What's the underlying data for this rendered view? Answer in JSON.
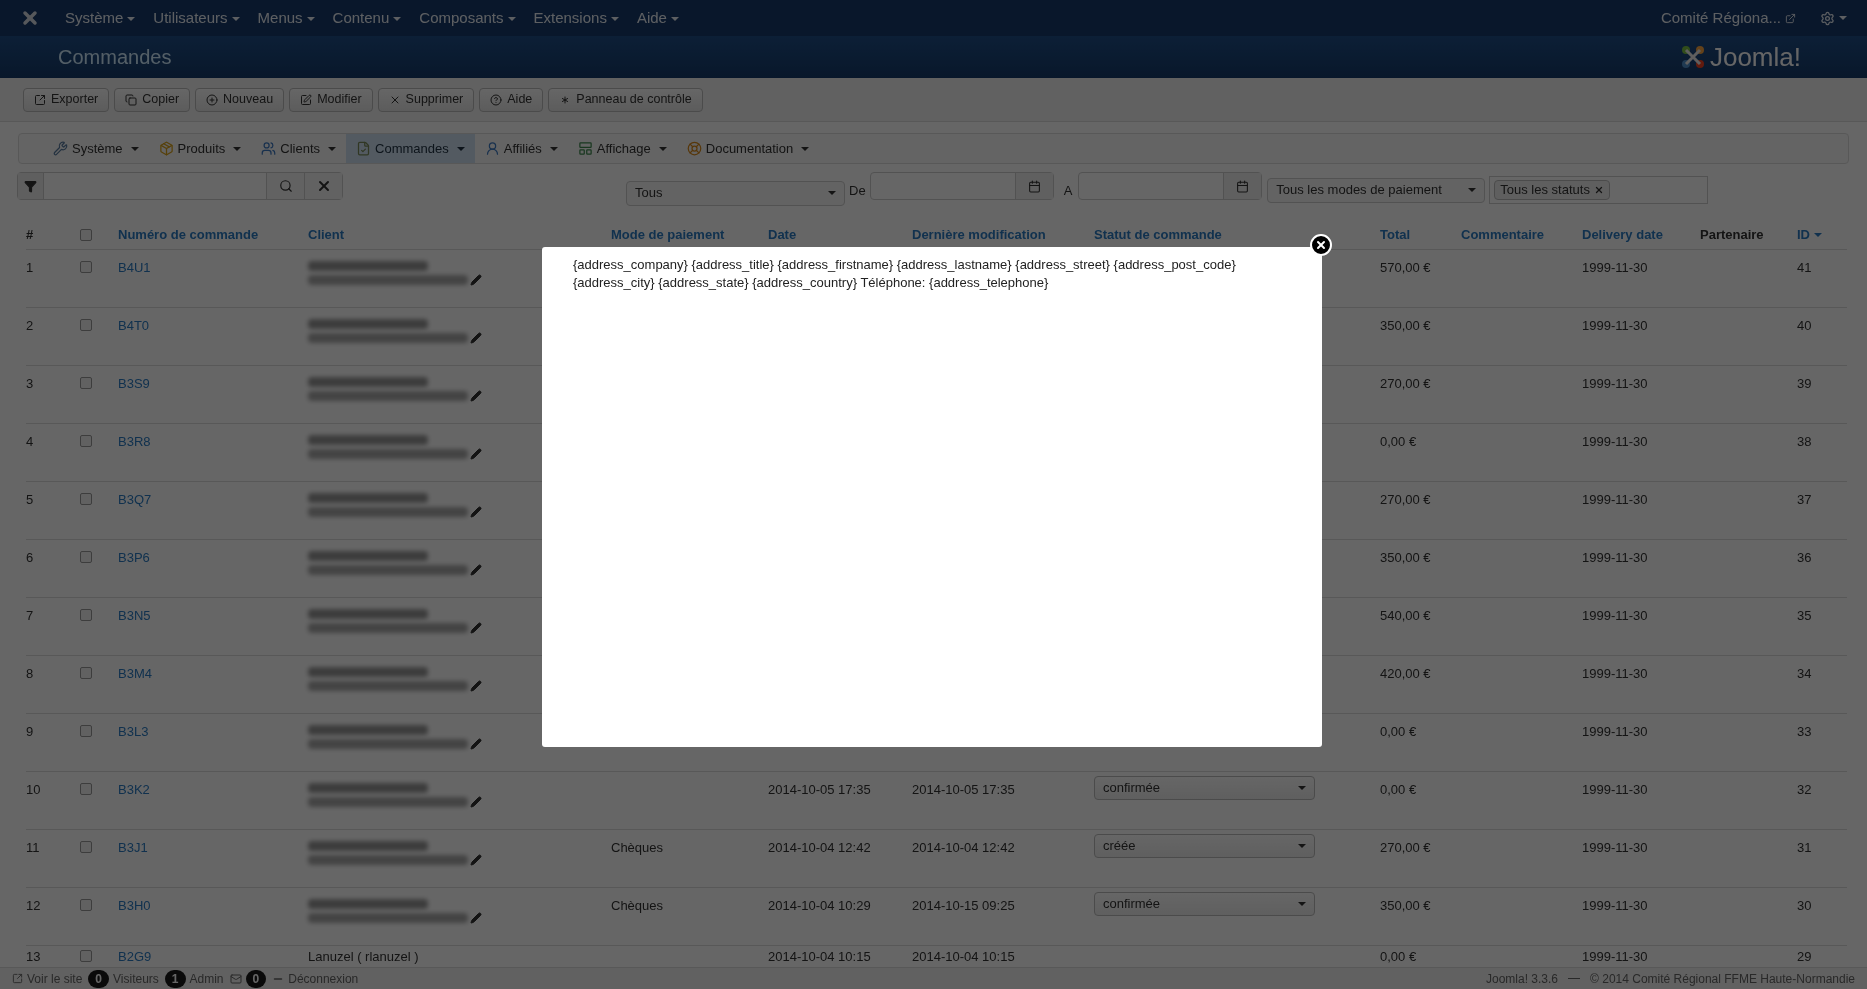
{
  "top_nav": {
    "menus": [
      "Système",
      "Utilisateurs",
      "Menus",
      "Contenu",
      "Composants",
      "Extensions",
      "Aide"
    ],
    "site_link": "Comité Régiona..."
  },
  "header": {
    "title": "Commandes",
    "logo_text": "Joomla!"
  },
  "toolbar": [
    "Exporter",
    "Copier",
    "Nouveau",
    "Modifier",
    "Supprimer",
    "Aide",
    "Panneau de contrôle"
  ],
  "submenu": [
    {
      "label": "Système",
      "selected": false
    },
    {
      "label": "Produits",
      "selected": false
    },
    {
      "label": "Clients",
      "selected": false
    },
    {
      "label": "Commandes",
      "selected": true
    },
    {
      "label": "Affiliés",
      "selected": false
    },
    {
      "label": "Affichage",
      "selected": false
    },
    {
      "label": "Documentation",
      "selected": false
    }
  ],
  "filters": {
    "period": "Tous",
    "from_label": "De",
    "to_label": "A",
    "payment": "Tous les modes de paiement",
    "status_tag": "Tous les statuts"
  },
  "table": {
    "columns": [
      {
        "label": "#",
        "link": false,
        "sorted": false
      },
      {
        "kind": "checkbox",
        "checked": false
      },
      {
        "label": "Numéro de commande",
        "link": true,
        "sorted": false
      },
      {
        "label": "Client",
        "link": true,
        "sorted": false
      },
      {
        "label": "Mode de paiement",
        "link": true,
        "sorted": false
      },
      {
        "label": "Date",
        "link": true,
        "sorted": false
      },
      {
        "label": "Dernière modification",
        "link": true,
        "sorted": false
      },
      {
        "label": "Statut de commande",
        "link": true,
        "sorted": false
      },
      {
        "label": "Total",
        "link": true,
        "sorted": false
      },
      {
        "label": "Commentaire",
        "link": true,
        "sorted": false
      },
      {
        "label": "Delivery date",
        "link": true,
        "sorted": false
      },
      {
        "label": "Partenaire",
        "link": false,
        "sorted": false
      },
      {
        "label": "ID",
        "link": true,
        "sorted": true
      }
    ],
    "rows": [
      {
        "num": "1",
        "checked": false,
        "order": "B4U1",
        "total": "570,00 €",
        "delivery": "1999-11-30",
        "id": "41"
      },
      {
        "num": "2",
        "checked": false,
        "order": "B4T0",
        "total": "350,00 €",
        "delivery": "1999-11-30",
        "id": "40"
      },
      {
        "num": "3",
        "checked": false,
        "order": "B3S9",
        "total": "270,00 €",
        "delivery": "1999-11-30",
        "id": "39"
      },
      {
        "num": "4",
        "checked": false,
        "order": "B3R8",
        "total": "0,00 €",
        "delivery": "1999-11-30",
        "id": "38"
      },
      {
        "num": "5",
        "checked": false,
        "order": "B3Q7",
        "total": "270,00 €",
        "delivery": "1999-11-30",
        "id": "37"
      },
      {
        "num": "6",
        "checked": false,
        "order": "B3P6",
        "total": "350,00 €",
        "delivery": "1999-11-30",
        "id": "36"
      },
      {
        "num": "7",
        "checked": false,
        "order": "B3N5",
        "total": "540,00 €",
        "delivery": "1999-11-30",
        "id": "35"
      },
      {
        "num": "8",
        "checked": false,
        "order": "B3M4",
        "total": "420,00 €",
        "delivery": "1999-11-30",
        "id": "34"
      },
      {
        "num": "9",
        "checked": false,
        "order": "B3L3",
        "total": "0,00 €",
        "delivery": "1999-11-30",
        "id": "33"
      },
      {
        "num": "10",
        "checked": false,
        "order": "B3K2",
        "date": "2014-10-05 17:35",
        "modified": "2014-10-05 17:35",
        "status": "confirmée",
        "total": "0,00 €",
        "delivery": "1999-11-30",
        "id": "32"
      },
      {
        "num": "11",
        "checked": false,
        "order": "B3J1",
        "payment": "Chèques",
        "date": "2014-10-04 12:42",
        "modified": "2014-10-04 12:42",
        "status": "créée",
        "total": "270,00 €",
        "delivery": "1999-11-30",
        "id": "31"
      },
      {
        "num": "12",
        "checked": false,
        "order": "B3H0",
        "payment": "Chèques",
        "date": "2014-10-04 10:29",
        "modified": "2014-10-15 09:25",
        "status": "confirmée",
        "total": "350,00 €",
        "delivery": "1999-11-30",
        "id": "30"
      },
      {
        "num": "13",
        "checked": false,
        "order": "B2G9",
        "client": "Lanuzel ( rlanuzel )",
        "date": "2014-10-04 10:15",
        "modified": "2014-10-04 10:15",
        "total": "0,00 €",
        "delivery": "1999-11-30",
        "id": "29"
      }
    ]
  },
  "modal": {
    "text": "{address_company} {address_title} {address_firstname} {address_lastname} {address_street} {address_post_code} {address_city} {address_state} {address_country} Téléphone: {address_telephone}"
  },
  "footer": {
    "items": [
      {
        "kind": "link",
        "label": "Voir le site"
      },
      {
        "kind": "badge",
        "count": "0",
        "label": "Visiteurs"
      },
      {
        "kind": "badge",
        "count": "1",
        "label": "Admin"
      },
      {
        "kind": "mail",
        "count": "0"
      },
      {
        "kind": "logout",
        "label": "Déconnexion"
      }
    ],
    "version": "Joomla! 3.3.6",
    "copyright": "© 2014 Comité Régional FFME Haute-Normandie"
  }
}
